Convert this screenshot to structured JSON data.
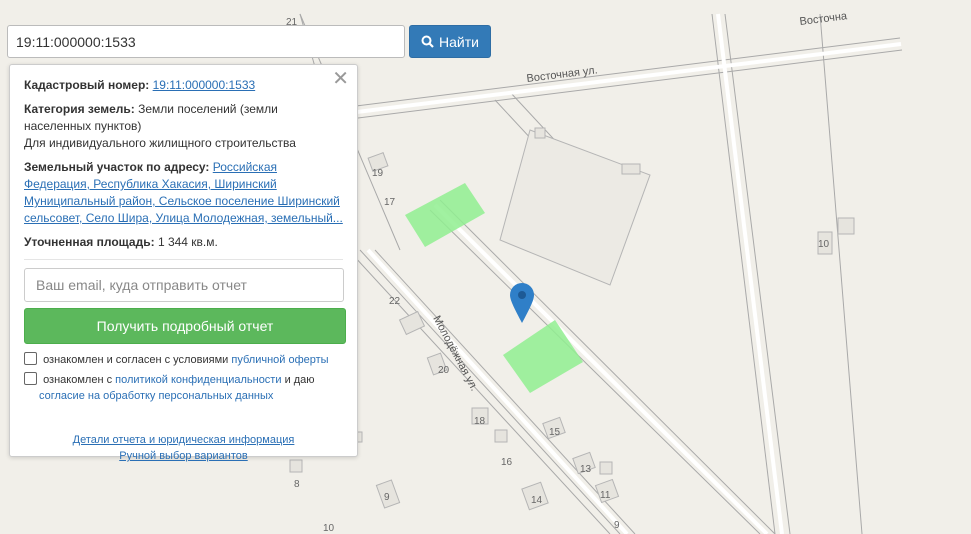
{
  "search": {
    "value": "19:11:000000:1533",
    "button_label": "Найти"
  },
  "info": {
    "cadastral_label": "Кадастровый номер:",
    "cadastral_value": "19:11:000000:1533",
    "category_label": "Категория земель:",
    "category_value_1": "Земли поселений (земли",
    "category_value_2": "населенных пунктов)",
    "category_value_3": "Для индивидуального жилищного строительства",
    "address_label": "Земельный участок по адресу:",
    "address_1": "Российская",
    "address_2": "Федерация, Республика Хакасия, Ширинский",
    "address_3": "Муниципальный район, Сельское поселение Ширинский",
    "address_4": "сельсовет, Село Шира, Улица Молодежная, земельный...",
    "area_label": "Уточненная площадь:",
    "area_value": "1 344 кв.м."
  },
  "form": {
    "email_placeholder": "Ваш email, куда отправить отчет",
    "submit_label": "Получить подробный отчет",
    "consent1_text": "ознакомлен и согласен с условиями",
    "consent1_link": "публичной оферты",
    "consent2_text": "ознакомлен с",
    "consent2_link": "политикой конфиденциальности",
    "consent2_mid": "и даю",
    "consent2_link2": "согласие на обработку персональных данных"
  },
  "footer": {
    "details_link": "Детали отчета и юридическая информация",
    "manual_link": "Ручной выбор вариантов"
  },
  "map": {
    "street_labels": [
      "Восточная ул.",
      "Восточна",
      "Молодёжная ул."
    ],
    "house_numbers": [
      "21",
      "19",
      "17",
      "10",
      "22",
      "20",
      "18",
      "16",
      "15",
      "14",
      "13",
      "11",
      "9",
      "8",
      "10",
      "9"
    ],
    "colors": {
      "background": "#f1efe9",
      "plot": "#90ee90",
      "marker": "#2f7fc8",
      "accent": "#337ab7",
      "green_button": "#5cb85c"
    }
  }
}
